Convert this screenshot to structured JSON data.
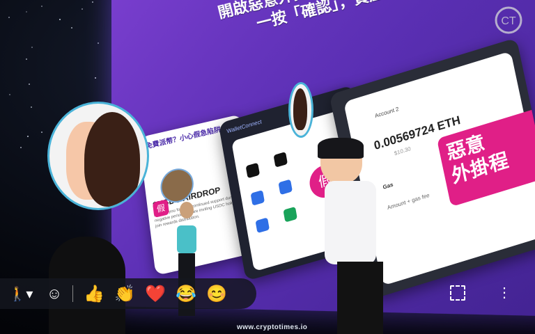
{
  "scene": {
    "wall_headline_line1": "開啟惡意外掛並連接錢包",
    "wall_headline_line2": "一按「確認」，資產隨即被盜"
  },
  "left_panel": {
    "header": "免費派幣？小心假急陷阱",
    "title": "$USDC AIRDROP",
    "body": "A thank you for your continued support during this negative period. We are inviting USDC holders to join rewards distribution."
  },
  "middle_panel": {
    "wallet_label": "WalletConnect",
    "fake_badge": "假"
  },
  "right_panel": {
    "account_label": "Account 2",
    "eth_amount": "0.00569724 ETH",
    "usd_amount": "$10.30",
    "gas_label": "Gas",
    "fee_row": "Amount + gas fee",
    "banner_line1": "惡意",
    "banner_line2": "外掛程"
  },
  "toolbar": {
    "emojis": [
      "👍",
      "👏",
      "❤️",
      "😂",
      "😊"
    ]
  },
  "watermark": "www.cryptotimes.io",
  "logo": "CT"
}
